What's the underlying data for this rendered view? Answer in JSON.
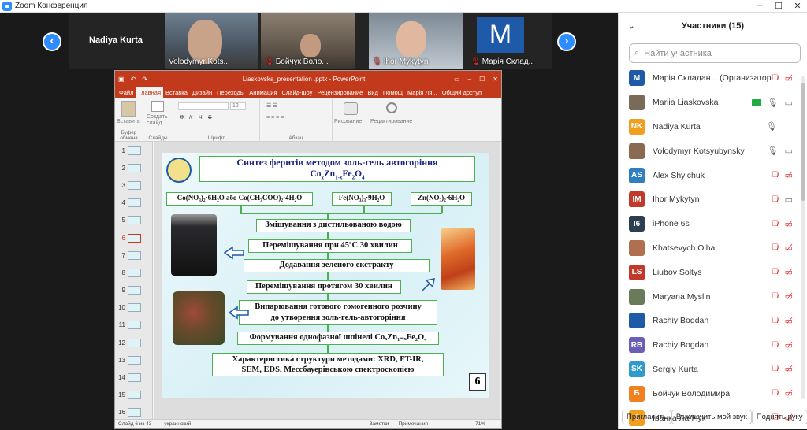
{
  "window": {
    "title": "Zoom Конференция"
  },
  "gallery": {
    "active_name": "Nadiya Kurta",
    "tiles": [
      {
        "name": "Volodymyr Kots...",
        "muted": false
      },
      {
        "name": "Бойчук Воло...",
        "muted": true
      },
      {
        "name": "Ihor Mykytyn",
        "muted": true
      },
      {
        "name": "Марія Склад...",
        "muted": true,
        "avatar": "M"
      }
    ]
  },
  "ppt": {
    "title": "Liaskovska_presentation .pptx - PowerPoint",
    "tabs": [
      "Файл",
      "Главная",
      "Вставка",
      "Дизайн",
      "Переходы",
      "Анимация",
      "Слайд-шоу",
      "Рецензирование",
      "Вид",
      "Помощ",
      "Марія Ля...",
      "Общий доступ"
    ],
    "ribbon": {
      "paste": "Вставить",
      "create_slide": "Создать слайд",
      "clipboard": "Буфер обмена",
      "slides": "Слайды",
      "font": "Шрифт",
      "paragraph": "Абзац",
      "drawing": "Рисование",
      "editing": "Редактирование",
      "font_size": "12"
    },
    "thumbs": [
      "1",
      "2",
      "3",
      "4",
      "5",
      "6",
      "7",
      "8",
      "9",
      "10",
      "11",
      "12",
      "13",
      "14",
      "15",
      "16"
    ],
    "status": {
      "slide": "Слайд 6 из 43",
      "lang": "украинский",
      "notes": "Заметки",
      "comments": "Примечания",
      "zoom": "71%"
    }
  },
  "slide": {
    "title1": "Синтез феритів методом золь-гель автогоріння",
    "title2": "CoxZn1-xFe2O4",
    "reagent1": "Co(NO₃)₂·6H₂O або Co(CH₃COO)₂·4H₂O",
    "reagent2": "Fe(NO₃)₃·9H₂O",
    "reagent3": "Zn(NO₃)₂·6H₂O",
    "steps": [
      "Змішування з дистильованою водою",
      "Перемішування при 45ºC  30 хвилин",
      "Додавання зеленого екстракту",
      "Перемішування протягом 30 хвилин",
      "Випарювання готового гомогенного розчину",
      "до утворення золь-гель-автогоріння",
      "Формування однофазної шпінелі CoₓZn₁₋ₓFe₂O₄",
      "Характеристика структури методами: XRD, FT-IR,",
      "SEM, EDS, Мессбауерівською спектроскопією"
    ],
    "page_number": "6"
  },
  "participants": {
    "header": "Участники (15)",
    "search_placeholder": "Найти участника",
    "list": [
      {
        "initials": "M",
        "name": "Марія Складан... (Организатор)",
        "color": "#1e5aa8",
        "mic": "muted",
        "cam": "off"
      },
      {
        "initials": "",
        "name": "Mariia Liaskovska",
        "color": "#7a6a5a",
        "mic": "on",
        "cam": "on",
        "share": true
      },
      {
        "initials": "NK",
        "name": "Nadiya Kurta",
        "color": "#f0a020",
        "mic": "on",
        "cam": "none"
      },
      {
        "initials": "",
        "name": "Volodymyr Kotsyubynsky",
        "color": "#8a6a50",
        "mic": "on",
        "cam": "on"
      },
      {
        "initials": "AS",
        "name": "Alex Shyichuk",
        "color": "#2f7fc0",
        "mic": "muted",
        "cam": "off"
      },
      {
        "initials": "IM",
        "name": "Ihor Mykytyn",
        "color": "#c0392b",
        "mic": "muted",
        "cam": "on"
      },
      {
        "initials": "I6",
        "name": "iPhone 6s",
        "color": "#2c3e50",
        "mic": "muted",
        "cam": "off"
      },
      {
        "initials": "",
        "name": "Khatsevych Olha",
        "color": "#b07050",
        "mic": "muted",
        "cam": "off"
      },
      {
        "initials": "LS",
        "name": "Liubov Soltys",
        "color": "#c0392b",
        "mic": "muted",
        "cam": "off"
      },
      {
        "initials": "",
        "name": "Maryana Myslin",
        "color": "#6a7a5a",
        "mic": "muted",
        "cam": "off"
      },
      {
        "initials": "",
        "name": "Rachiy Bogdan",
        "color": "#1e5aa8",
        "mic": "muted",
        "cam": "off"
      },
      {
        "initials": "RB",
        "name": "Rachiy Bogdan",
        "color": "#6b5fb5",
        "mic": "muted",
        "cam": "off"
      },
      {
        "initials": "SK",
        "name": "Sergiy Kurta",
        "color": "#2f9acb",
        "mic": "muted",
        "cam": "off"
      },
      {
        "initials": "Б",
        "name": "Бойчук Володимира",
        "color": "#f08020",
        "mic": "muted",
        "cam": "off"
      },
      {
        "initials": "I",
        "name": "Іванка Лапчук",
        "color": "#f0a020",
        "mic": "muted",
        "cam": "off"
      }
    ],
    "invite": "Пригласить",
    "mute_mine": "Выключить мой звук",
    "raise_hand": "Поднять руку"
  }
}
